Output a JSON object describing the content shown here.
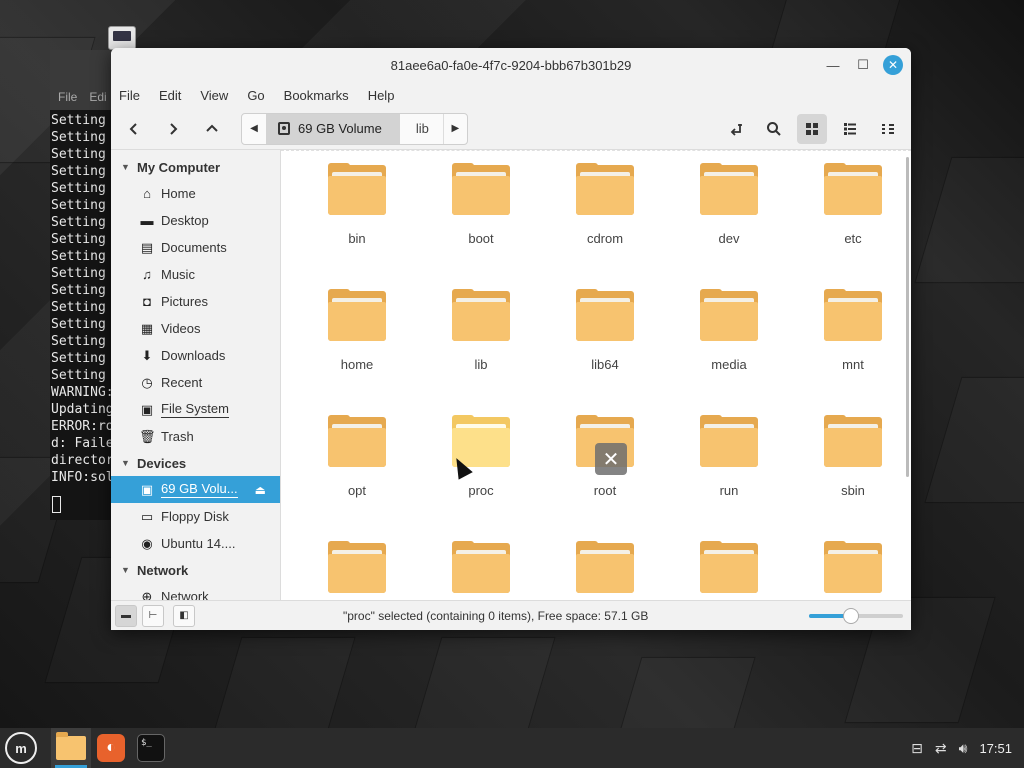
{
  "terminal": {
    "menu": [
      "File",
      "Edi"
    ],
    "lines": [
      "Setting",
      "Setting",
      "Setting",
      "Setting",
      "Setting",
      "Setting",
      "Setting",
      "Setting",
      "Setting",
      "Setting",
      "Setting",
      "Setting",
      "Setting",
      "Setting",
      "Setting",
      "Setting",
      "WARNING:",
      "Updating",
      "ERROR:ro",
      "d: Faile",
      "director",
      "INFO:sol"
    ]
  },
  "window": {
    "title": "81aee6a0-fa0e-4f7c-9204-bbb67b301b29"
  },
  "menubar": [
    "File",
    "Edit",
    "View",
    "Go",
    "Bookmarks",
    "Help"
  ],
  "pathbar": {
    "active": "69 GB Volume",
    "next": "lib"
  },
  "sidebar": {
    "sections": [
      {
        "title": "My Computer",
        "items": [
          {
            "label": "Home",
            "icon": "home-icon"
          },
          {
            "label": "Desktop",
            "icon": "desktop-icon"
          },
          {
            "label": "Documents",
            "icon": "documents-icon"
          },
          {
            "label": "Music",
            "icon": "music-icon"
          },
          {
            "label": "Pictures",
            "icon": "camera-icon"
          },
          {
            "label": "Videos",
            "icon": "film-icon"
          },
          {
            "label": "Downloads",
            "icon": "download-icon"
          },
          {
            "label": "Recent",
            "icon": "clock-icon"
          },
          {
            "label": "File System",
            "icon": "drive-icon"
          },
          {
            "label": "Trash",
            "icon": "trash-icon"
          }
        ]
      },
      {
        "title": "Devices",
        "items": [
          {
            "label": "69 GB Volu...",
            "icon": "drive-icon",
            "selected": true
          },
          {
            "label": "Floppy Disk",
            "icon": "floppy-icon"
          },
          {
            "label": "Ubuntu 14....",
            "icon": "disc-icon"
          }
        ]
      },
      {
        "title": "Network",
        "items": [
          {
            "label": "Network",
            "icon": "network-icon"
          }
        ]
      }
    ]
  },
  "files": [
    "bin",
    "boot",
    "cdrom",
    "dev",
    "etc",
    "home",
    "lib",
    "lib64",
    "media",
    "mnt",
    "opt",
    "proc",
    "root",
    "run",
    "sbin",
    "",
    "",
    "",
    "",
    ""
  ],
  "selected_file": "proc",
  "status": {
    "text": "\"proc\" selected (containing 0 items), Free space: 57.1 GB",
    "zoom_fraction": 0.45
  },
  "taskbar": {
    "clock": "17:51"
  },
  "colors": {
    "accent": "#35a0d8",
    "folder": "#f7c36f"
  }
}
